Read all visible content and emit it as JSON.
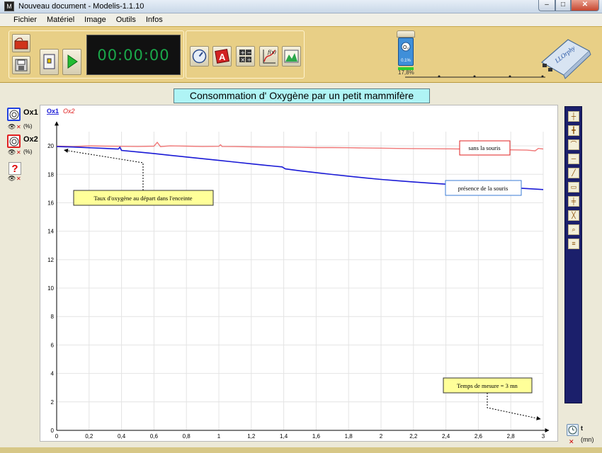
{
  "window": {
    "title": "Nouveau document - Modelis-1.1.10",
    "app_icon": "M"
  },
  "menu": [
    "Fichier",
    "Matériel",
    "Image",
    "Outils",
    "Infos"
  ],
  "toolbar": {
    "timer": "00:00:00",
    "battery_level": "17,8%",
    "sensor_reading": "0.1%"
  },
  "channels": [
    {
      "name": "Ox1",
      "unit": "(%)",
      "color": "#1a1ad6"
    },
    {
      "name": "Ox2",
      "unit": "(%)",
      "color": "#e02020"
    }
  ],
  "chart_data": {
    "type": "line",
    "title": "Consommation d' Oxygène par un petit mammifère",
    "x_unit": "t",
    "x_unit2": "(mn)",
    "xlim": [
      0,
      3
    ],
    "ylim": [
      0,
      21
    ],
    "x_ticks": [
      "0",
      "0,2",
      "0,4",
      "0,6",
      "0,8",
      "1",
      "1,2",
      "1,4",
      "1,6",
      "1,8",
      "2",
      "2,2",
      "2,4",
      "2,6",
      "2,8",
      "3"
    ],
    "y_ticks": [
      "0",
      "2",
      "4",
      "6",
      "8",
      "10",
      "12",
      "14",
      "16",
      "18",
      "20"
    ],
    "legend": [
      "Ox1",
      "Ox2"
    ],
    "grid": true,
    "series": [
      {
        "name": "Ox1",
        "color": "#1a1ad6",
        "x": [
          0,
          0.1,
          0.2,
          0.3,
          0.38,
          0.39,
          0.4,
          0.5,
          0.6,
          0.7,
          0.8,
          0.9,
          1.0,
          1.1,
          1.2,
          1.3,
          1.39,
          1.41,
          1.5,
          1.6,
          1.7,
          1.8,
          1.9,
          2.0,
          2.1,
          2.2,
          2.3,
          2.4,
          2.5,
          2.6,
          2.7,
          2.8,
          2.9,
          3.0
        ],
        "y": [
          19.95,
          19.92,
          19.87,
          19.82,
          19.78,
          19.9,
          19.68,
          19.57,
          19.46,
          19.34,
          19.22,
          19.1,
          18.98,
          18.86,
          18.74,
          18.62,
          18.52,
          18.38,
          18.25,
          18.12,
          17.99,
          17.87,
          17.75,
          17.64,
          17.55,
          17.46,
          17.38,
          17.31,
          17.25,
          17.18,
          17.12,
          17.06,
          17.0,
          16.93
        ]
      },
      {
        "name": "Ox2",
        "color": "#f07878",
        "x": [
          0,
          0.1,
          0.2,
          0.3,
          0.4,
          0.5,
          0.6,
          0.62,
          0.64,
          0.7,
          0.8,
          0.9,
          1.0,
          1.01,
          1.02,
          1.1,
          1.2,
          1.3,
          1.4,
          1.5,
          1.6,
          1.7,
          1.8,
          1.9,
          2.0,
          2.1,
          2.2,
          2.3,
          2.4,
          2.5,
          2.6,
          2.7,
          2.8,
          2.9,
          2.95,
          2.97,
          3.0
        ],
        "y": [
          19.98,
          19.95,
          20.0,
          19.98,
          19.97,
          19.96,
          19.98,
          20.25,
          19.95,
          20.0,
          19.98,
          19.96,
          19.97,
          20.08,
          19.96,
          19.95,
          19.93,
          19.92,
          19.92,
          19.9,
          19.88,
          19.88,
          19.87,
          19.85,
          19.84,
          19.82,
          19.81,
          19.8,
          19.79,
          19.78,
          19.77,
          19.75,
          19.72,
          19.7,
          19.65,
          19.82,
          19.78
        ]
      }
    ],
    "annotations": [
      {
        "text": "Taux d'oxygène au départ dans l'enceinte",
        "target": [
          0.02,
          19.9
        ],
        "style": "yellow"
      },
      {
        "text": "Temps de mesure = 3 mn",
        "target": [
          3.0,
          0.4
        ],
        "style": "yellow"
      },
      {
        "text": "sans la souris",
        "style": "red"
      },
      {
        "text": "présence de la souris",
        "style": "blue"
      }
    ]
  }
}
